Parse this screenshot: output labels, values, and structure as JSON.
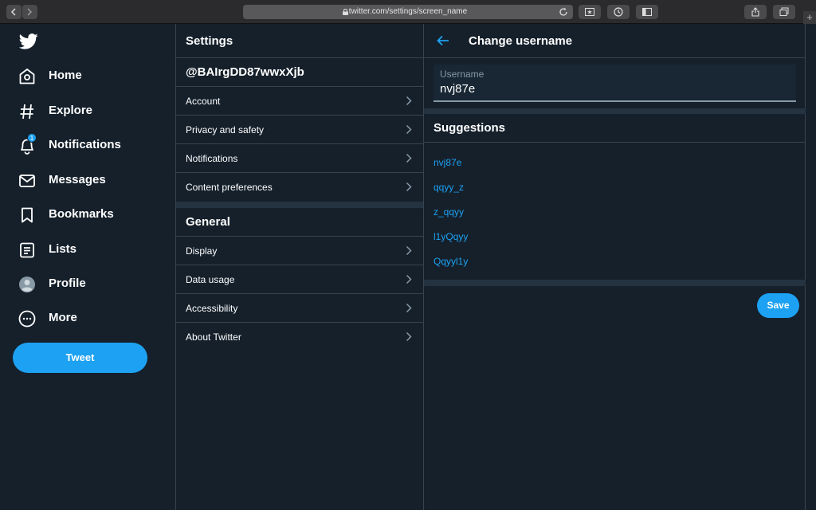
{
  "browser": {
    "url": "twitter.com/settings/screen_name"
  },
  "nav": {
    "items": [
      {
        "label": "Home",
        "icon": "home-icon"
      },
      {
        "label": "Explore",
        "icon": "hashtag-icon"
      },
      {
        "label": "Notifications",
        "icon": "bell-icon",
        "badge": "1"
      },
      {
        "label": "Messages",
        "icon": "envelope-icon"
      },
      {
        "label": "Bookmarks",
        "icon": "bookmark-icon"
      },
      {
        "label": "Lists",
        "icon": "list-icon"
      },
      {
        "label": "Profile",
        "icon": "avatar-icon"
      },
      {
        "label": "More",
        "icon": "more-icon"
      }
    ],
    "tweet_label": "Tweet"
  },
  "settings": {
    "title": "Settings",
    "handle": "@BAIrgDD87wwxXjb",
    "account_rows": [
      "Account",
      "Privacy and safety",
      "Notifications",
      "Content preferences"
    ],
    "general_title": "General",
    "general_rows": [
      "Display",
      "Data usage",
      "Accessibility",
      "About Twitter"
    ]
  },
  "change_username": {
    "title": "Change username",
    "field_label": "Username",
    "field_value": "nvj87e",
    "suggestions_title": "Suggestions",
    "suggestions": [
      "nvj87e",
      "qqyy_z",
      "z_qqyy",
      "l1yQqyy",
      "Qqyyl1y"
    ],
    "save_label": "Save"
  },
  "colors": {
    "background": "#15202b",
    "accent": "#1da1f2",
    "border": "#38444d"
  }
}
